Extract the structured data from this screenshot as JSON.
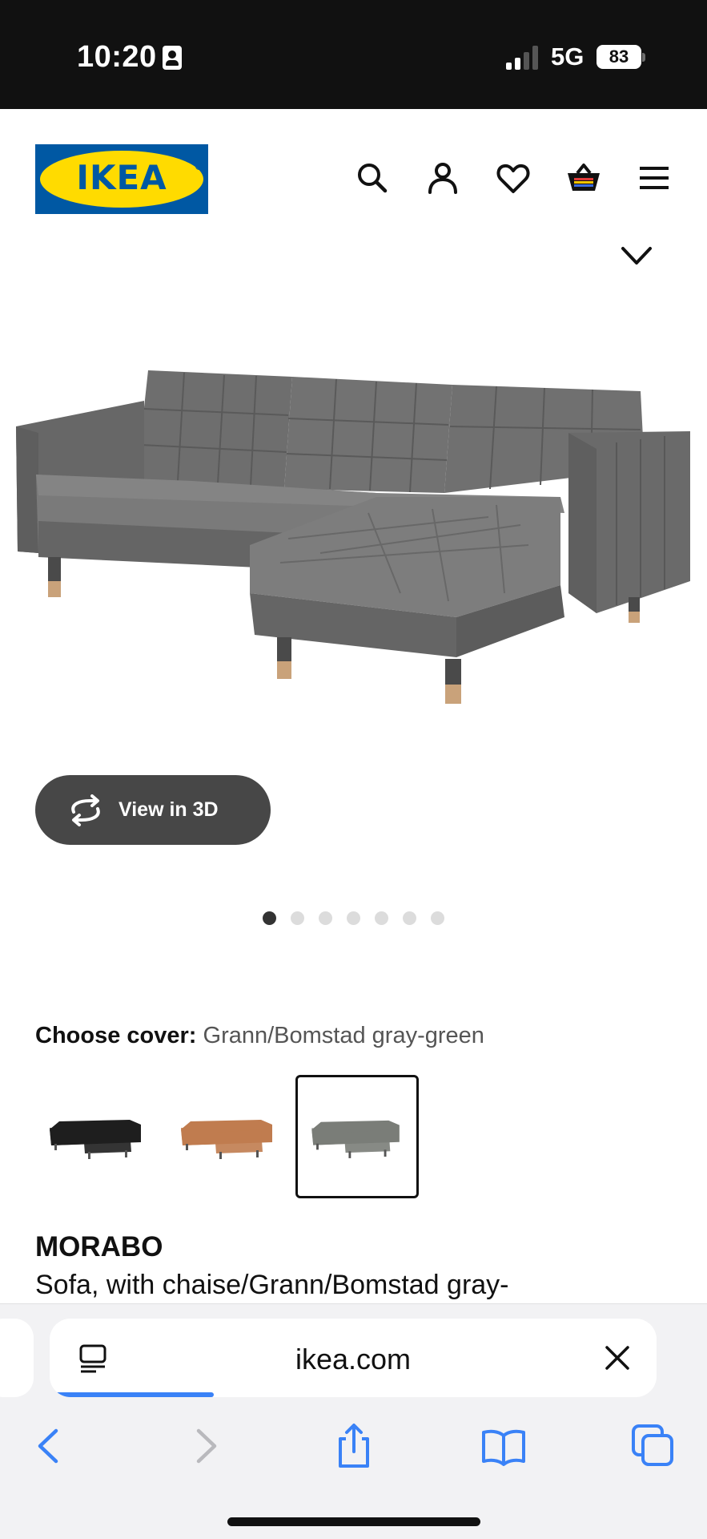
{
  "status_bar": {
    "time": "10:20",
    "network": "5G",
    "battery": "83"
  },
  "header": {
    "logo_text": "IKEA",
    "icons": [
      "search-icon",
      "account-icon",
      "heart-icon",
      "basket-icon",
      "menu-icon"
    ]
  },
  "gallery": {
    "view_3d_label": "View in 3D",
    "dot_count": 7,
    "active_dot": 1
  },
  "cover": {
    "label": "Choose cover:",
    "value": "Grann/Bomstad gray-green",
    "swatches": [
      {
        "color": "#1e1e1e",
        "selected": false
      },
      {
        "color": "#c07c4f",
        "selected": false
      },
      {
        "color": "#7a7d78",
        "selected": true
      }
    ]
  },
  "product": {
    "name": "MORABO",
    "description": "Sofa, with chaise/Grann/Bomstad gray-"
  },
  "browser": {
    "url": "ikea.com",
    "load_progress": 0.27
  },
  "colors": {
    "ikea_blue": "#0058a3",
    "ikea_yellow": "#ffdb00",
    "sofa": "#707070",
    "accent": "#3a82f7"
  }
}
